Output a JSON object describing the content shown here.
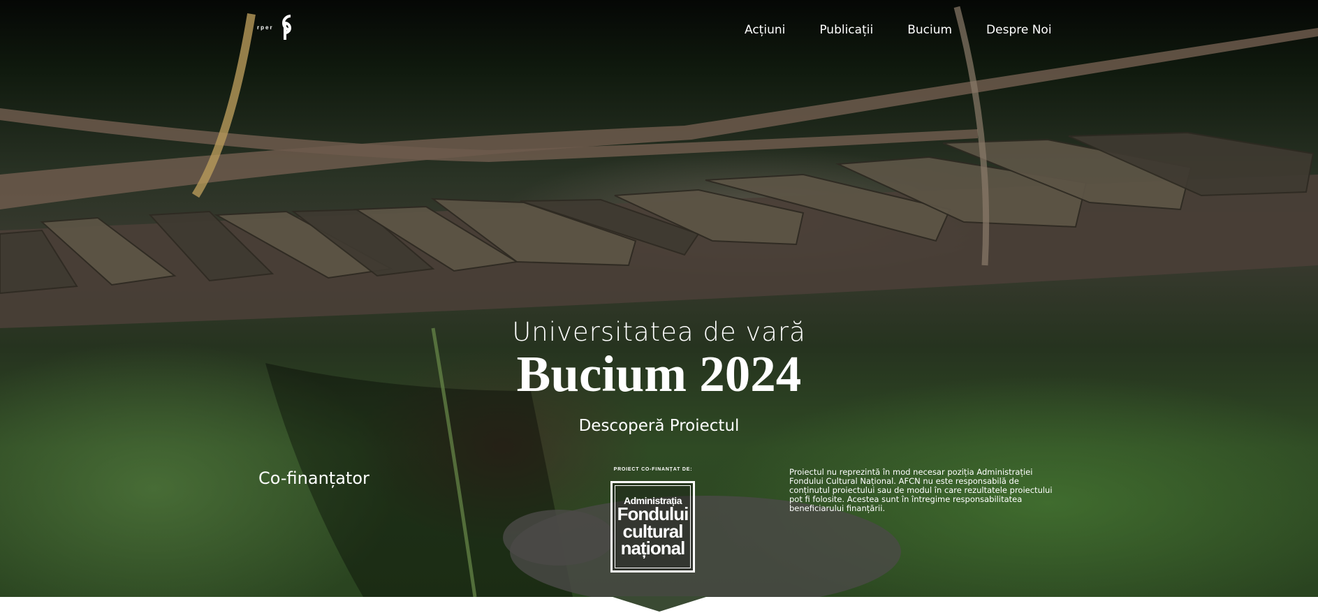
{
  "header": {
    "logo_text": "rper",
    "nav": [
      {
        "label": "Acțiuni"
      },
      {
        "label": "Publicații"
      },
      {
        "label": "Bucium"
      },
      {
        "label": "Despre Noi"
      }
    ]
  },
  "hero": {
    "subtitle": "Universitatea de vară",
    "title": "Bucium 2024",
    "cta": "Descoperă Proiectul"
  },
  "funding": {
    "cofinantator_label": "Co-finanțator",
    "project_label": "PROIECT CO-FINANȚAT DE:",
    "afcn_logo": {
      "line1": "Administrația",
      "line2": "Fondului",
      "line3": "cultural",
      "line4": "național"
    },
    "disclaimer": "Proiectul nu reprezintă în mod necesar poziția Administrației Fondului Cultural Național. AFCN nu este responsabilă de conținutul proiectului sau de modul în care rezultatele proiectului pot fi folosite. Acestea sunt în întregime responsabilitatea beneficiarului finanțării."
  },
  "icons": {
    "logo": "cp-logo-icon"
  },
  "colors": {
    "text": "#ffffff",
    "background_bottom": "#ffffff"
  }
}
